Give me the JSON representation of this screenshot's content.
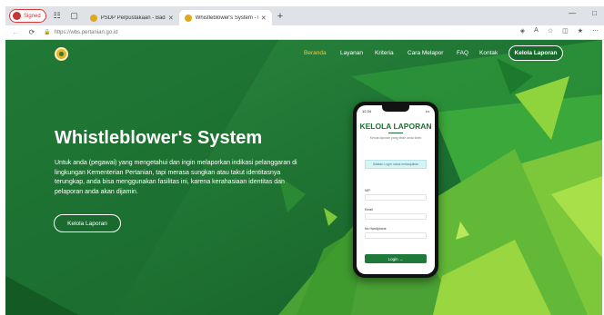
{
  "browser": {
    "profile_label": "Signed",
    "tabs": [
      {
        "title": "PSDP Perpustakaan - Badan Besar Per",
        "active": false
      },
      {
        "title": "Whistleblower's System - Kementerian",
        "active": true
      }
    ],
    "url": "https://wbs.pertanian.go.id",
    "icons": {
      "profile": "profile-avatar-icon",
      "workspaces": "workspaces-icon",
      "tab_actions": "tab-actions-icon",
      "new_tab": "plus-icon",
      "back": "back-arrow-icon",
      "refresh": "refresh-icon",
      "lock": "lock-icon"
    }
  },
  "site": {
    "nav": {
      "items": [
        "Beranda",
        "Layanan",
        "Kriteria",
        "Cara Melapor",
        "FAQ",
        "Kontak"
      ],
      "active": "Beranda",
      "cta": "Kelola Laporan"
    },
    "hero": {
      "title": "Whistleblower's System",
      "description": "Untuk anda (pegawai) yang mengetahui dan ingin melaporkan indikasi pelanggaran di lingkungan Kementerian Pertanian, tapi merasa sungkan atau takut identitasnya terungkap, anda bisa menggunakan fasilitas ini, karena kerahasiaan identitas dan pelaporan anda akan dijamin.",
      "button": "Kelola Laporan"
    },
    "phone": {
      "time": "12:34",
      "status": "•••",
      "title": "KELOLA LAPORAN",
      "subtitle": "Kelola laporan yang telah anda kirim",
      "info": "Silakan Login untuk melanjutkan",
      "fields": [
        "NIP",
        "Email",
        "No Handphone"
      ],
      "login_button": "Login →"
    },
    "colors": {
      "primary_green": "#1f7a36",
      "accent_yellow": "#f2c94c"
    }
  }
}
